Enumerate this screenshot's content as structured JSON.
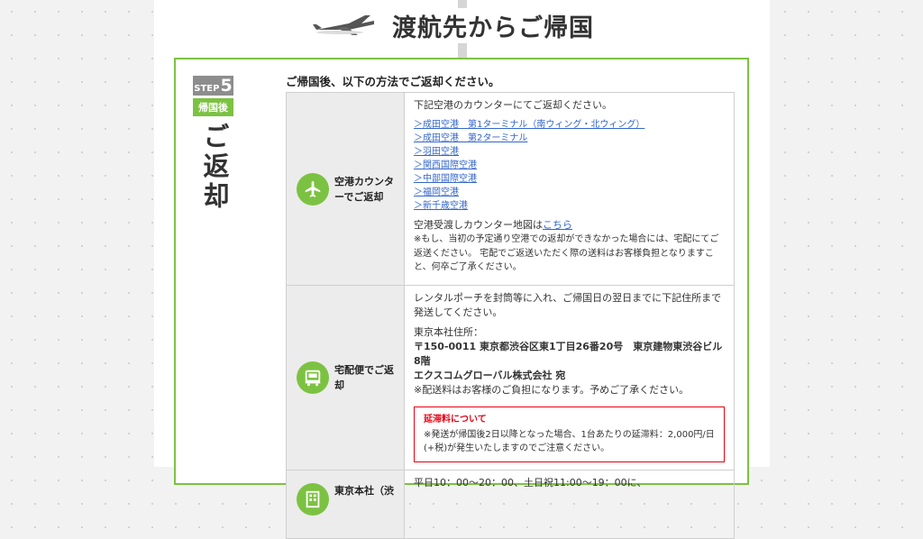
{
  "header": {
    "title": "渡航先からご帰国",
    "icon": "airplane-icon"
  },
  "step": {
    "word": "STEP",
    "number": "5",
    "phase": "帰国後",
    "title": "ご返却"
  },
  "intro": "ご帰国後、以下の方法でご返却ください。",
  "colors": {
    "accent_green": "#7cc242",
    "badge_gray": "#8d8d8d",
    "link_blue": "#3366cc",
    "notice_red": "#e60012"
  },
  "methods": [
    {
      "label_line1": "空港カウンタ",
      "label_line2": "ーでご返却",
      "icon": "airplane-icon",
      "lead": "下記空港のカウンターにてご返却ください。",
      "airports": [
        "＞成田空港　第1ターミナル（南ウィング・北ウィング）",
        "＞成田空港　第2ターミナル",
        "＞羽田空港",
        "＞関西国際空港",
        "＞中部国際空港",
        "＞福岡空港",
        "＞新千歳空港"
      ],
      "map_text": "空港受渡しカウンター地図は",
      "map_link": "こちら",
      "note": "※もし、当初の予定通り空港での返却ができなかった場合には、宅配にてご返送ください。 宅配でご返送いただく際の送料はお客様負担となりますこと、何卒ご了承ください。"
    },
    {
      "label_line1": "宅配便でご返",
      "label_line2": "却",
      "icon": "truck-icon",
      "lead": "レンタルポーチを封筒等に入れ、ご帰国日の翌日までに下記住所まで発送してください。",
      "address_label": "東京本社住所：",
      "address_line1": "〒150-0011 東京都渋谷区東1丁目26番20号　東京建物東渋谷ビル8階",
      "address_line2": "エクスコムグローバル株式会社 宛",
      "shipping_note": "※配送料はお客様のご負担になります。予めご了承ください。",
      "notice_title": "延滞料について",
      "notice_text": "※発送が帰国後2日以降となった場合、1台あたりの延滞料：2,000円/日(+税)が発生いたしますのでご注意ください。"
    },
    {
      "label_line1": "東京本社（渋",
      "icon": "building-icon",
      "lead": "平日10：00～20：00、土日祝11:00～19：00に、"
    }
  ]
}
